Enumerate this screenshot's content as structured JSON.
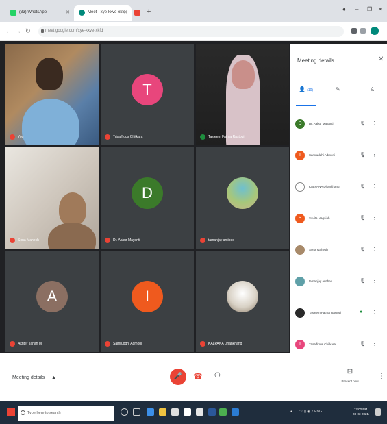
{
  "browser": {
    "tabs": [
      {
        "label": "(33) WhatsApp"
      },
      {
        "label": "Meet - xye-kxve-xkfd"
      },
      {
        "label": ""
      }
    ],
    "address": "meet.google.com/xye-kxve-xkfd"
  },
  "tiles": [
    {
      "name": "You",
      "type": "video",
      "mic_on": false
    },
    {
      "name": "Trisaffrous Chitkara",
      "type": "avatar",
      "initial": "T",
      "color": "#e8467c",
      "mic_on": false
    },
    {
      "name": "Tasleem Fatma Rastogi",
      "type": "video",
      "mic_on": true
    },
    {
      "name": "Sona Mahesh",
      "type": "video",
      "mic_on": false
    },
    {
      "name": "Dr. Aakur Mayanti",
      "type": "avatar",
      "initial": "D",
      "color": "#3b7a2a",
      "mic_on": false
    },
    {
      "name": "tamanjay antibed",
      "type": "photo",
      "mic_on": false
    },
    {
      "name": "Akhter Jahan M.",
      "type": "avatar",
      "initial": "A",
      "color": "#8b6f62",
      "mic_on": false
    },
    {
      "name": "Samruddhi Admoni",
      "type": "avatar",
      "initial": "I",
      "color": "#ef5a1e",
      "mic_on": false
    },
    {
      "name": "KALPANA Dhankhang",
      "type": "photo",
      "mic_on": false
    }
  ],
  "panel": {
    "title": "Meeting details",
    "people_count": "(10)",
    "participants": [
      {
        "name": "Dr. Aakur Mayanti",
        "initial": "D",
        "color": "#3b7a2a",
        "speaking": false
      },
      {
        "name": "Samruddhi Admoni",
        "initial": "I",
        "color": "#ef5a1e",
        "speaking": false
      },
      {
        "name": "KALPANA Dhankhang",
        "initial": "",
        "color": "#6d6d6d",
        "speaking": false
      },
      {
        "name": "Savita Nagaiah",
        "initial": "S",
        "color": "#ef5a1e",
        "speaking": false
      },
      {
        "name": "Sona Mahesh",
        "initial": "",
        "color": "#a88a6a",
        "speaking": false
      },
      {
        "name": "tamanjay antibed",
        "initial": "",
        "color": "#5fa0a8",
        "speaking": false
      },
      {
        "name": "Tasleem Fatma Rastogi",
        "initial": "",
        "color": "#2a2a2a",
        "speaking": true
      },
      {
        "name": "Trisaffrous Chitkara",
        "initial": "T",
        "color": "#e8467c",
        "speaking": false
      }
    ]
  },
  "controls": {
    "meeting_details": "Meeting details",
    "present_now": "Present now"
  },
  "taskbar": {
    "search_placeholder": "Type here to search",
    "time": "12:00 PM",
    "date": "23-03-2021"
  }
}
